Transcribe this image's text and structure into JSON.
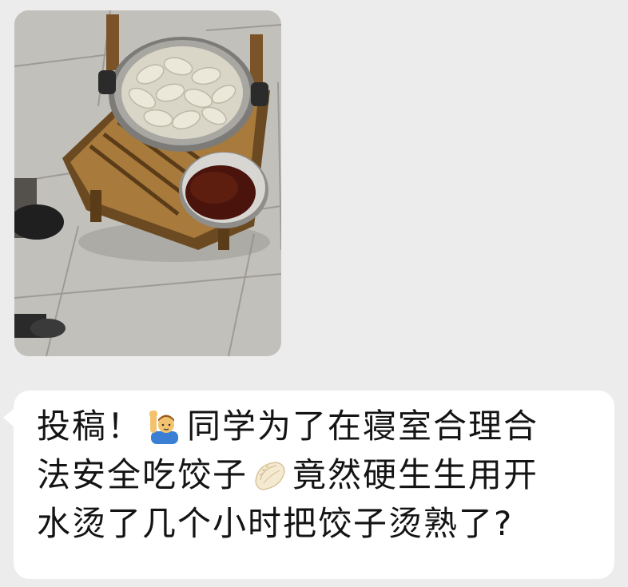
{
  "photo": {
    "subject": "dumplings in a pot on a dorm chair",
    "icon": "dumpling-photo"
  },
  "message": {
    "line1_part1": "投稿！",
    "line1_part2": "同学为了在寝室合理合",
    "line2_part1": "法安全吃饺子",
    "line2_part2": "竟然硬生生用开",
    "line3": "水烫了几个小时把饺子烫熟了?"
  },
  "emoji": {
    "raising_hand": "person-raising-hand-icon",
    "dumpling": "dumpling-icon"
  },
  "colors": {
    "background": "#ececec",
    "bubble": "#ffffff",
    "text": "#141414"
  }
}
